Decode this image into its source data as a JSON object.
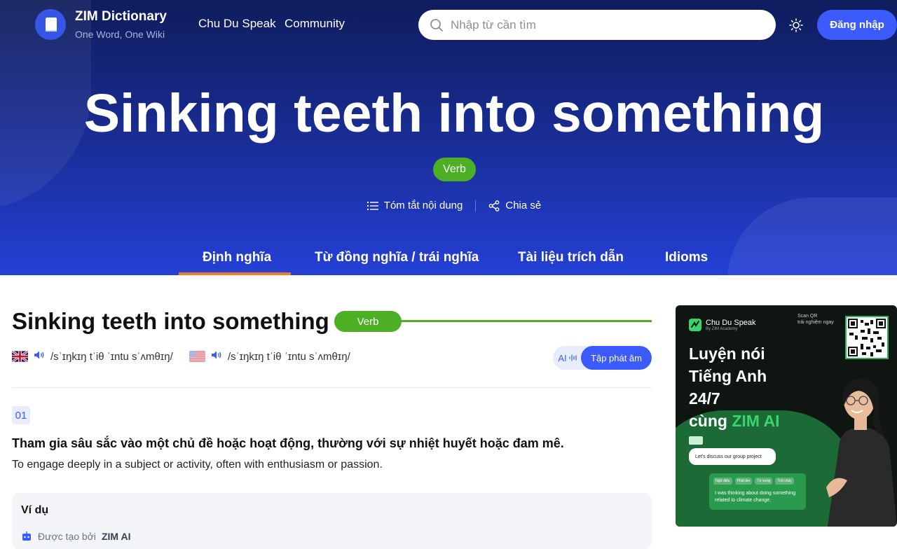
{
  "header": {
    "logo_title": "ZIM Dictionary",
    "logo_subtitle": "One Word, One Wiki",
    "nav": [
      "Chu Du Speak",
      "Community"
    ],
    "search_placeholder": "Nhập từ cần tìm",
    "login_label": "Đăng nhập"
  },
  "hero": {
    "title": "Sinking teeth into something",
    "part_of_speech": "Verb",
    "actions": [
      "Tóm tắt nội dung",
      "Chia sẻ"
    ]
  },
  "tabs": {
    "items": [
      "Định nghĩa",
      "Từ đồng nghĩa / trái nghĩa",
      "Tài liệu trích dẫn",
      "Idioms"
    ],
    "active": "Định nghĩa"
  },
  "entry": {
    "title": "Sinking teeth into something",
    "part_of_speech": "Verb",
    "pron_uk": "/sˈɪŋkɪŋ tˈiθ ˈɪntu sˈʌmθɪŋ/",
    "pron_us": "/sˈɪŋkɪŋ tˈiθ ˈɪntu sˈʌmθɪŋ/",
    "practice_ai": "AI",
    "practice_label": "Tập phát âm",
    "definitions": [
      {
        "number": "01",
        "vi": "Tham gia sâu sắc vào một chủ đề hoặc hoạt động, thường với sự nhiệt huyết hoặc đam mê.",
        "en": "To engage deeply in a subject or activity, often with enthusiasm or passion."
      }
    ],
    "example_title": "Ví dụ",
    "ai_note_prefix": "Được tạo bởi",
    "ai_note_brand": "ZIM AI"
  },
  "ad": {
    "brand": "Chu Du Speak",
    "brand_sub": "By ZIM Academy",
    "scan_line1": "Scan QR",
    "scan_line2": "trải nghiệm ngay",
    "headline_1": "Luyện nói",
    "headline_2": "Tiếng Anh",
    "headline_3": "24/7",
    "headline_4_pre": "cùng ",
    "headline_4_hl": "ZIM AI",
    "bubble": "Let's discuss our group project",
    "chips": [
      "Ngữ điệu",
      "Phát âm",
      "Từ vựng",
      "Trôi chảy"
    ],
    "card_text": "I was thinking about doing something related to climate change."
  },
  "colors": {
    "hero_top": "#0f1d5c",
    "hero_bottom": "#2440d6",
    "accent_blue": "#3b5bfd",
    "verb_green": "#4caf24",
    "tab_underline": "#f07a2a"
  }
}
